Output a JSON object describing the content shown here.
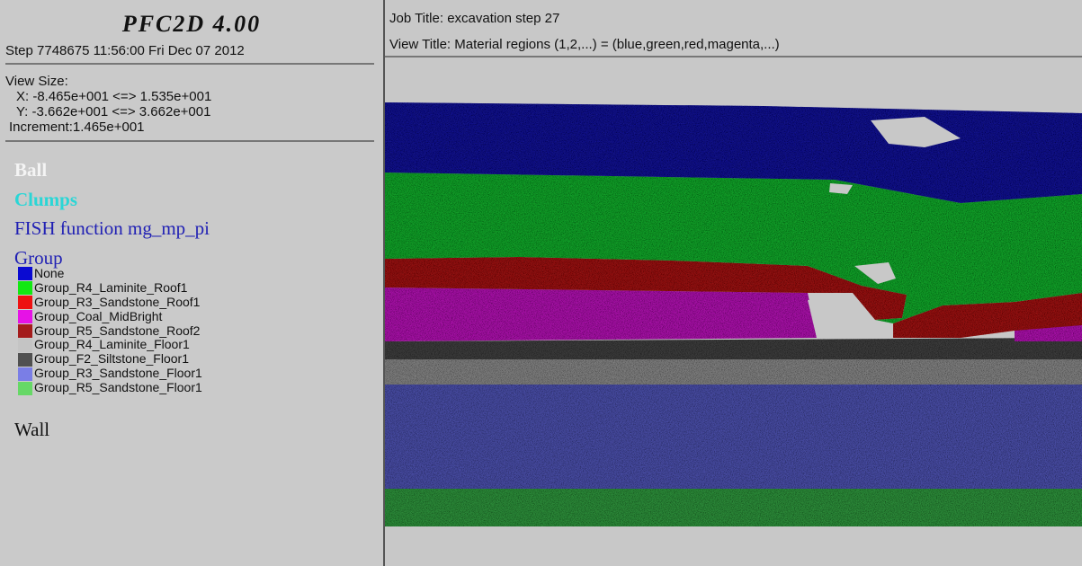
{
  "app": {
    "title": "PFC2D 4.00",
    "step_line": "Step 7748675  11:56:00 Fri Dec 07 2012"
  },
  "view_size": {
    "label": "View Size:",
    "x_line": "X: -8.465e+001 <=> 1.535e+001",
    "y_line": "Y: -3.662e+001 <=> 3.662e+001",
    "increment_line": "Increment:1.465e+001"
  },
  "plot_items": {
    "ball": "Ball",
    "clumps": "Clumps",
    "fish": "FISH function mg_mp_pi",
    "group": "Group",
    "wall": "Wall"
  },
  "legend": [
    {
      "label": "None",
      "color": "#0a0ad2"
    },
    {
      "label": "Group_R4_Laminite_Roof1",
      "color": "#12e812"
    },
    {
      "label": "Group_R3_Sandstone_Roof1",
      "color": "#ee1111"
    },
    {
      "label": "Group_Coal_MidBright",
      "color": "#e612e6"
    },
    {
      "label": "Group_R5_Sandstone_Roof2",
      "color": "#a41c1c"
    },
    {
      "label": "Group_R4_Laminite_Floor1",
      "color": "#c4c4c4"
    },
    {
      "label": "Group_F2_Siltstone_Floor1",
      "color": "#505050"
    },
    {
      "label": "Group_R3_Sandstone_Floor1",
      "color": "#7a7ee6"
    },
    {
      "label": "Group_R5_Sandstone_Floor1",
      "color": "#66d866"
    }
  ],
  "header": {
    "job_title": "Job Title: excavation step 27",
    "view_title": "View Title: Material regions (1,2,...) = (blue,green,red,magenta,...)"
  },
  "colors": {
    "ball_text": "#f4f4f4",
    "clumps_text": "#2ad6d6",
    "fish_text": "#2020b4",
    "group_text": "#2020b4",
    "wall_text": "#111111",
    "layer_blue": "#14148c",
    "layer_green": "#16a02c",
    "layer_red": "#961818",
    "layer_magenta": "#a818a8",
    "layer_dark": "#3c3c3c",
    "layer_grey": "#808080",
    "layer_periwinkle": "#4a4ea4",
    "layer_floor_green": "#2e8c3a",
    "void": "#c8c8c8"
  }
}
